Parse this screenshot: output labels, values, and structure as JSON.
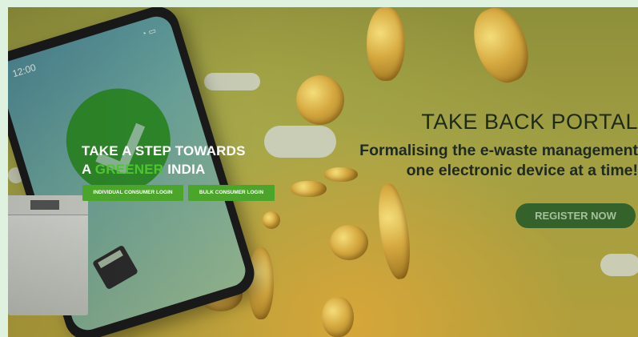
{
  "phone": {
    "time": "12:00",
    "status_icons": "wifi-icon battery-icon"
  },
  "hero": {
    "line1": "TAKE A STEP TOWARDS",
    "line2_prefix": "A ",
    "line2_green": "GREENER",
    "line2_suffix": " INDIA",
    "buttons": {
      "individual": "INDIVIDUAL CONSUMER LOGIN",
      "bulk": "BULK CONSUMER LOGIN"
    }
  },
  "portal": {
    "title": "TAKE BACK PORTAL",
    "tagline_line1": "Formalising the e-waste management",
    "tagline_line2": "one electronic device at a time!",
    "register": "REGISTER NOW"
  },
  "colors": {
    "page_bg": "#dff1df",
    "button_green": "#4aa52a",
    "accent_green": "#4fc431",
    "register_bg": "#35622a"
  }
}
